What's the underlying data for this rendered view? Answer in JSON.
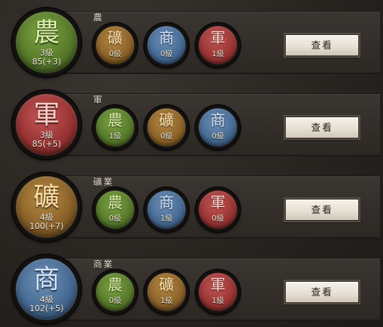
{
  "rows": [
    {
      "title": "農",
      "main": {
        "glyph": "農",
        "level": "3級",
        "points": "85(+3)",
        "color": "farm"
      },
      "others": [
        {
          "glyph": "礦",
          "level": "0級",
          "color": "mine"
        },
        {
          "glyph": "商",
          "level": "0級",
          "color": "trade"
        },
        {
          "glyph": "軍",
          "level": "1級",
          "color": "army"
        }
      ],
      "button": "查看"
    },
    {
      "title": "軍",
      "main": {
        "glyph": "軍",
        "level": "3級",
        "points": "85(+5)",
        "color": "army"
      },
      "others": [
        {
          "glyph": "農",
          "level": "1級",
          "color": "farm"
        },
        {
          "glyph": "礦",
          "level": "0級",
          "color": "mine"
        },
        {
          "glyph": "商",
          "level": "0級",
          "color": "trade"
        }
      ],
      "button": "查看"
    },
    {
      "title": "礦業",
      "main": {
        "glyph": "礦",
        "level": "4級",
        "points": "100(+7)",
        "color": "mine"
      },
      "others": [
        {
          "glyph": "農",
          "level": "0級",
          "color": "farm"
        },
        {
          "glyph": "商",
          "level": "1級",
          "color": "trade"
        },
        {
          "glyph": "軍",
          "level": "0級",
          "color": "army"
        }
      ],
      "button": "查看"
    },
    {
      "title": "商業",
      "main": {
        "glyph": "商",
        "level": "4級",
        "points": "102(+5)",
        "color": "trade"
      },
      "others": [
        {
          "glyph": "農",
          "level": "0級",
          "color": "farm"
        },
        {
          "glyph": "礦",
          "level": "1級",
          "color": "mine"
        },
        {
          "glyph": "軍",
          "level": "1級",
          "color": "army"
        }
      ],
      "button": "查看"
    }
  ],
  "colors": {
    "farm": "#577a2a",
    "mine": "#8b6128",
    "trade": "#466a93",
    "army": "#9a3434",
    "button_bg": "#e5ded2"
  }
}
